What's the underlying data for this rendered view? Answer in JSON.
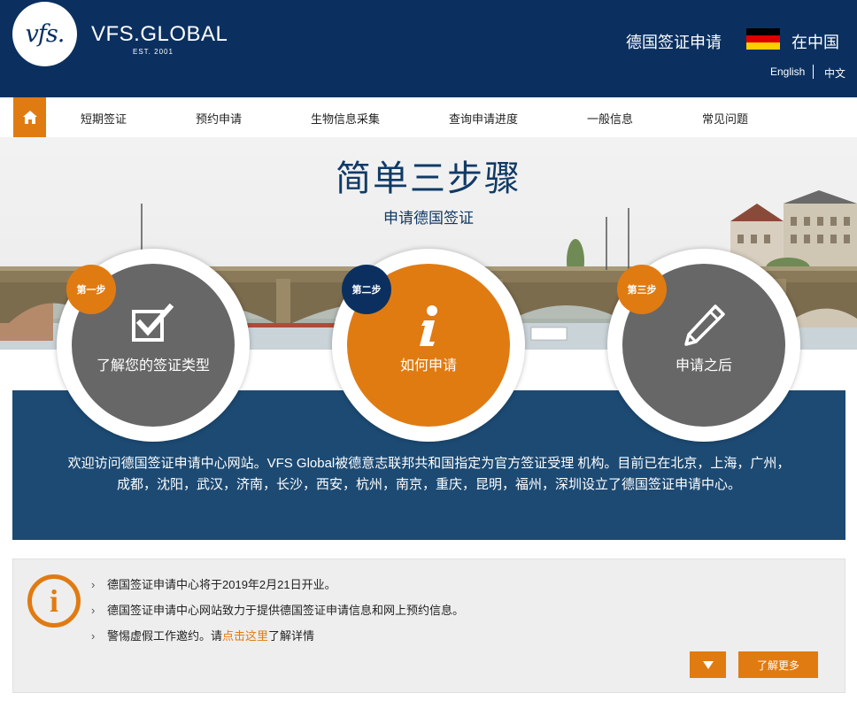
{
  "header": {
    "logo_text": "vfs.",
    "brand": "VFS.GLOBAL",
    "est": "EST. 2001",
    "title_left": "德国签证申请",
    "title_right": "在中国",
    "flag_colors": [
      "#000000",
      "#dd0000",
      "#ffce00"
    ],
    "lang_en": "English",
    "lang_cn": "中文"
  },
  "nav": {
    "home_icon": "home-icon",
    "items": [
      "短期签证",
      "预约申请",
      "生物信息采集",
      "查询申请进度",
      "一般信息",
      "常见问题"
    ]
  },
  "hero": {
    "title": "简单三步骤",
    "subtitle": "申请德国签证"
  },
  "steps": [
    {
      "badge": "第一步",
      "label": "了解您的签证类型",
      "icon": "checkbox-icon",
      "color": "#676767",
      "badge_color": "#e07b12"
    },
    {
      "badge": "第二步",
      "label": "如何申请",
      "icon": "info-icon",
      "color": "#e07b12",
      "badge_color": "#0b3060"
    },
    {
      "badge": "第三步",
      "label": "申请之后",
      "icon": "pencil-icon",
      "color": "#676767",
      "badge_color": "#e07b12"
    }
  ],
  "band": {
    "text": "欢迎访问德国签证申请中心网站。VFS Global被德意志联邦共和国指定为官方签证受理 机构。目前已在北京，上海，广州，成都，沈阳，武汉，济南，长沙，西安，杭州，南京，重庆，昆明，福州，深圳设立了德国签证申请中心。"
  },
  "notice": {
    "icon": "info-circle-icon",
    "items": [
      "德国签证申请中心将于2019年2月21日开业。",
      "德国签证申请中心网站致力于提供德国签证申请信息和网上预约信息。"
    ],
    "item3_prefix": "警惕虚假工作邀约。请",
    "item3_link": "点击这里",
    "item3_suffix": "了解详情",
    "expand_icon": "triangle-down-icon",
    "more_button": "了解更多"
  },
  "colors": {
    "navy": "#0b3060",
    "orange": "#e07b12",
    "band": "#1c4a73"
  }
}
